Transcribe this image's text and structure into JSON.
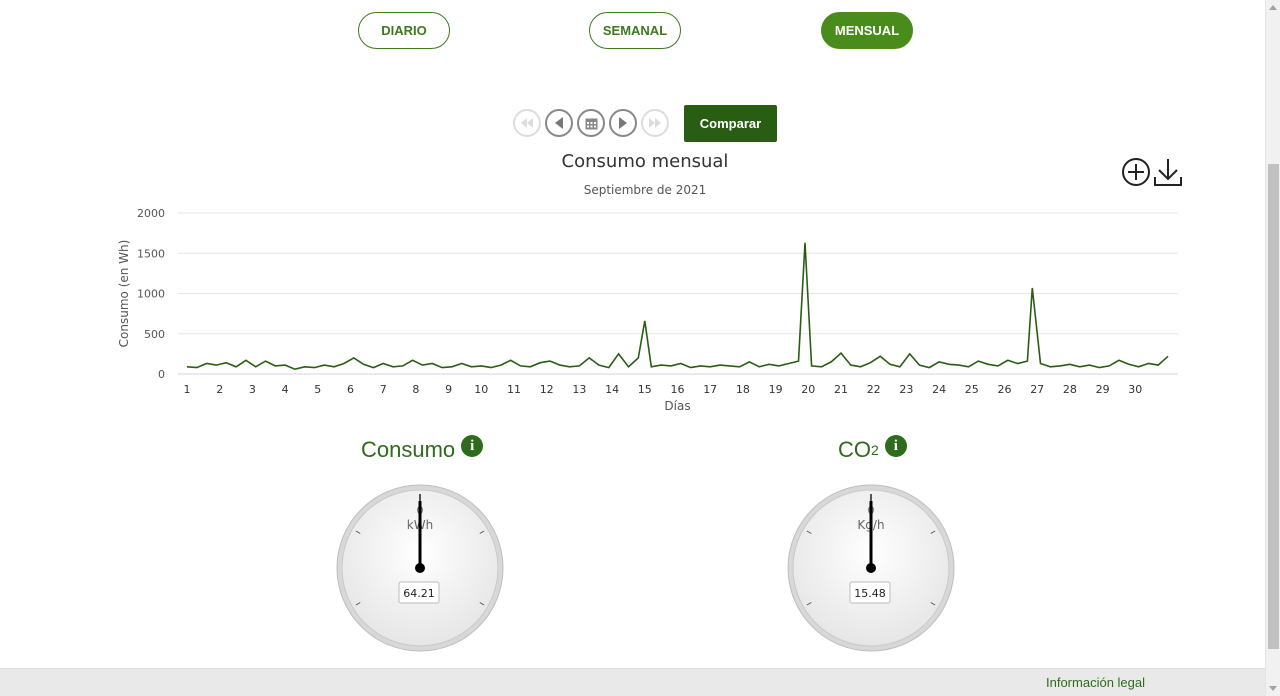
{
  "periods": [
    {
      "label": "DIARIO",
      "active": false
    },
    {
      "label": "SEMANAL",
      "active": false
    },
    {
      "label": "MENSUAL",
      "active": true
    }
  ],
  "navigation": {
    "compare_label": "Comparar"
  },
  "icons": {
    "first": "fast-backward-icon",
    "prev": "play-back-icon",
    "calendar": "calendar-icon",
    "next": "play-forward-icon",
    "last": "fast-forward-icon",
    "zoom": "zoom-plus-icon",
    "download": "download-icon",
    "info": "info-icon"
  },
  "colors": {
    "brand_green": "#2f6b1c",
    "active_green": "#4a8c1c",
    "line_green": "#2a5d14"
  },
  "chart_data": {
    "type": "line",
    "title": "Consumo mensual",
    "subtitle": "Septiembre de 2021",
    "xlabel": "Días",
    "ylabel": "Consumo (en Wh)",
    "ylim": [
      0,
      2000
    ],
    "yticks": [
      0,
      500,
      1000,
      1500,
      2000
    ],
    "xlim": [
      1,
      31
    ],
    "xticks": [
      "1",
      "2",
      "3",
      "4",
      "5",
      "6",
      "7",
      "8",
      "9",
      "10",
      "11",
      "12",
      "13",
      "14",
      "15",
      "16",
      "17",
      "18",
      "19",
      "20",
      "21",
      "22",
      "23",
      "24",
      "25",
      "26",
      "27",
      "28",
      "29",
      "30"
    ],
    "grid": true,
    "series": [
      {
        "color": "#2a5d14",
        "x": [
          1,
          1.3,
          1.6,
          1.9,
          2.2,
          2.5,
          2.8,
          3.1,
          3.4,
          3.7,
          4,
          4.3,
          4.6,
          4.9,
          5.2,
          5.5,
          5.8,
          6.1,
          6.4,
          6.7,
          7,
          7.3,
          7.6,
          7.9,
          8.2,
          8.5,
          8.8,
          9.1,
          9.4,
          9.7,
          10,
          10.3,
          10.6,
          10.9,
          11.2,
          11.5,
          11.8,
          12.1,
          12.4,
          12.7,
          13,
          13.3,
          13.6,
          13.9,
          14.2,
          14.5,
          14.8,
          15,
          15.2,
          15.5,
          15.8,
          16.1,
          16.4,
          16.7,
          17,
          17.3,
          17.6,
          17.9,
          18.2,
          18.5,
          18.8,
          19.1,
          19.4,
          19.7,
          19.9,
          20.1,
          20.4,
          20.7,
          21,
          21.3,
          21.6,
          21.9,
          22.2,
          22.5,
          22.8,
          23.1,
          23.4,
          23.7,
          24,
          24.3,
          24.6,
          24.9,
          25.2,
          25.5,
          25.8,
          26.1,
          26.4,
          26.7,
          26.85,
          27.1,
          27.4,
          27.7,
          28,
          28.3,
          28.6,
          28.9,
          29.2,
          29.5,
          29.8,
          30.1,
          30.4,
          30.7,
          31
        ],
        "y": [
          90,
          80,
          130,
          110,
          140,
          90,
          170,
          90,
          160,
          100,
          110,
          60,
          90,
          80,
          110,
          90,
          130,
          200,
          120,
          80,
          130,
          90,
          100,
          170,
          110,
          130,
          80,
          90,
          130,
          90,
          100,
          80,
          110,
          170,
          100,
          90,
          140,
          160,
          110,
          90,
          100,
          200,
          110,
          80,
          250,
          90,
          200,
          660,
          90,
          110,
          100,
          130,
          80,
          100,
          90,
          110,
          100,
          90,
          150,
          90,
          120,
          100,
          130,
          160,
          1630,
          100,
          90,
          150,
          260,
          110,
          90,
          140,
          220,
          120,
          90,
          250,
          110,
          80,
          150,
          120,
          110,
          90,
          160,
          120,
          100,
          170,
          130,
          160,
          1070,
          130,
          90,
          100,
          120,
          90,
          110,
          80,
          100,
          170,
          120,
          90,
          130,
          110,
          220
        ]
      }
    ]
  },
  "gauges": [
    {
      "title": "Consumo",
      "sub": "",
      "unit": "kWh",
      "zero_label": "0",
      "value": 64.21,
      "value_label": "64.21"
    },
    {
      "title": "CO",
      "sub": "2",
      "unit": "Kg/h",
      "zero_label": "0",
      "value": 15.48,
      "value_label": "15.48"
    }
  ],
  "footer": {
    "legal_label": "Información legal"
  }
}
